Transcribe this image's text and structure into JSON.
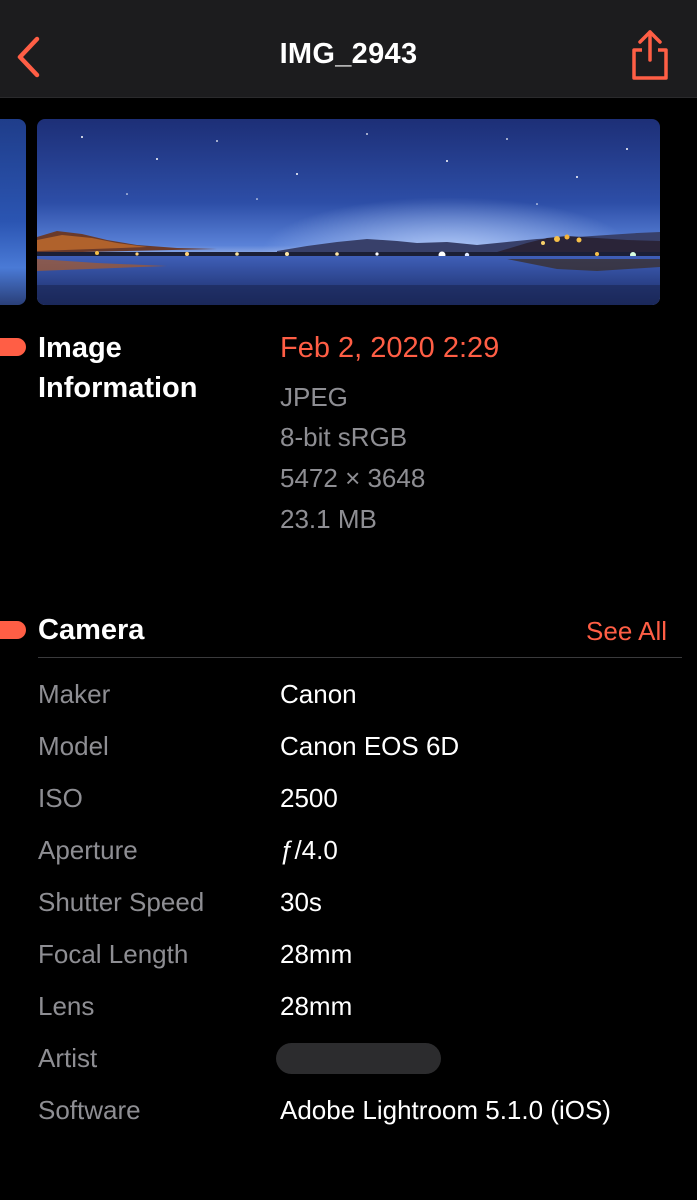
{
  "nav": {
    "title": "IMG_2943",
    "back_icon": "chevron-left-icon",
    "share_icon": "share-icon",
    "accent": "#ff5e45"
  },
  "info": {
    "heading_line1": "Image",
    "heading_line2": "Information",
    "date": "Feb 2, 2020 2:29",
    "format": "JPEG",
    "color_profile": "8-bit sRGB",
    "dimensions": "5472 × 3648",
    "file_size": "23.1 MB"
  },
  "camera": {
    "heading": "Camera",
    "see_all": "See All",
    "rows": [
      {
        "label": "Maker",
        "value": "Canon"
      },
      {
        "label": "Model",
        "value": "Canon EOS 6D"
      },
      {
        "label": "ISO",
        "value": "2500"
      },
      {
        "label": "Aperture",
        "value": "ƒ/4.0"
      },
      {
        "label": "Shutter Speed",
        "value": "30s"
      },
      {
        "label": "Focal Length",
        "value": "28mm"
      },
      {
        "label": "Lens",
        "value": "28mm"
      },
      {
        "label": "Artist",
        "value": ""
      },
      {
        "label": "Software",
        "value": "Adobe Lightroom 5.1.0 (iOS)"
      }
    ]
  },
  "colors": {
    "background": "#000000",
    "navbar": "#1c1c1e",
    "secondary_text": "#8e8e93",
    "accent": "#ff5e45"
  }
}
